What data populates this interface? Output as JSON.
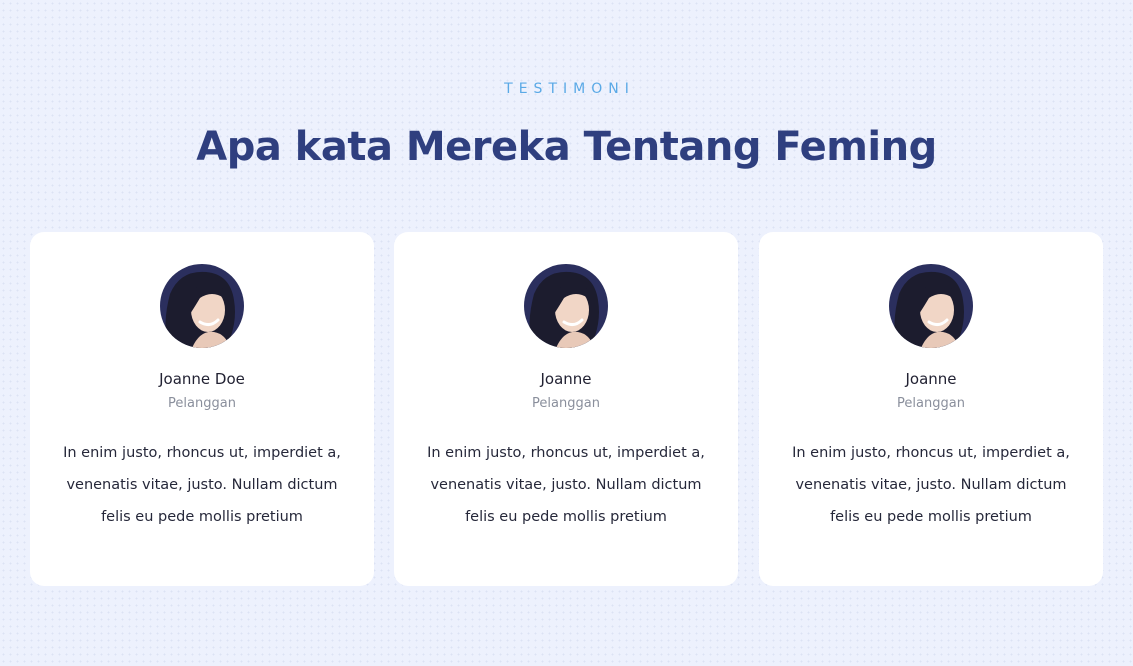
{
  "section": {
    "eyebrow": "TESTIMONI",
    "title": "Apa kata Mereka Tentang Feming"
  },
  "testimonials": [
    {
      "name": "Joanne Doe",
      "role": "Pelanggan",
      "quote": "In enim justo, rhoncus ut, imperdiet a, venenatis vitae, justo. Nullam dictum felis eu pede mollis pretium"
    },
    {
      "name": "Joanne",
      "role": "Pelanggan",
      "quote": "In enim justo, rhoncus ut, imperdiet a, venenatis vitae, justo. Nullam dictum felis eu pede mollis pretium"
    },
    {
      "name": "Joanne",
      "role": "Pelanggan",
      "quote": "In enim justo, rhoncus ut, imperdiet a, venenatis vitae, justo. Nullam dictum felis eu pede mollis pretium"
    }
  ],
  "colors": {
    "background": "#edf1fd",
    "eyebrow": "#5aa9e6",
    "title": "#2f3f7f",
    "card": "#ffffff",
    "avatar_bg": "#2b2f5e"
  },
  "icons": {
    "avatar": "user-photo-avatar"
  }
}
